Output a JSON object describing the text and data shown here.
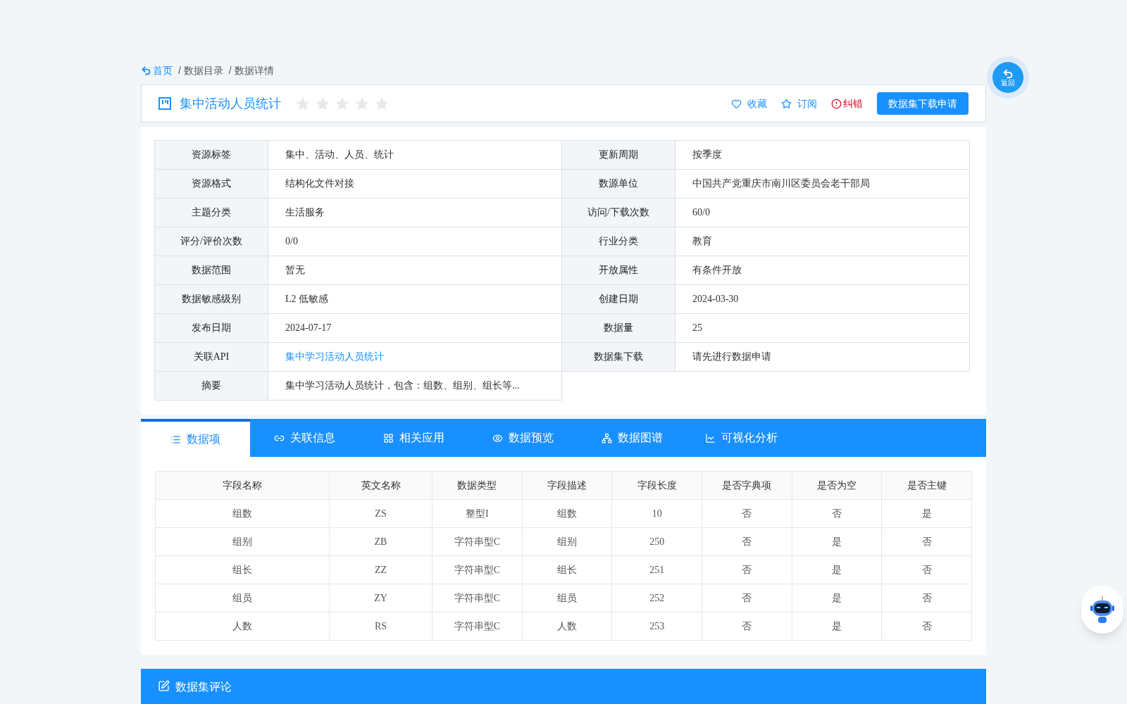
{
  "breadcrumb": [
    {
      "label": "首页",
      "kind": "home"
    },
    {
      "label": "/ 数据目录",
      "kind": "plain"
    },
    {
      "label": "/ 数据详情",
      "kind": "plain"
    }
  ],
  "header": {
    "title": "集中活动人员统计",
    "stars": 0,
    "actions": [
      {
        "label": "收藏",
        "kind": "heart"
      },
      {
        "label": "订阅",
        "kind": "star"
      },
      {
        "label": "纠错",
        "kind": "alert"
      }
    ],
    "button": "数据集下载申请"
  },
  "back_button": "返回",
  "info": [
    {
      "label": "资源标签",
      "value": "集中、活动、人员、统计",
      "kind": "text"
    },
    {
      "label": "更新周期",
      "value": "按季度",
      "kind": "text"
    },
    {
      "label": "资源格式",
      "value": "结构化文件对接",
      "kind": "text"
    },
    {
      "label": "数源单位",
      "value": "中国共产党重庆市南川区委员会老干部局",
      "kind": "text"
    },
    {
      "label": "主题分类",
      "value": "生活服务",
      "kind": "text"
    },
    {
      "label": "访问/下载次数",
      "value": "60/0",
      "kind": "text"
    },
    {
      "label": "评分/评价次数",
      "value": "0/0",
      "kind": "text"
    },
    {
      "label": "行业分类",
      "value": "教育",
      "kind": "text"
    },
    {
      "label": "数据范围",
      "value": "暂无",
      "kind": "text"
    },
    {
      "label": "开放属性",
      "value": "有条件开放",
      "kind": "text"
    },
    {
      "label": "数据敏感级别",
      "value": "L2 低敏感",
      "kind": "text"
    },
    {
      "label": "创建日期",
      "value": "2024-03-30",
      "kind": "text"
    },
    {
      "label": "发布日期",
      "value": "2024-07-17",
      "kind": "text"
    },
    {
      "label": "数据量",
      "value": "25",
      "kind": "text"
    },
    {
      "label": "关联API",
      "value": "集中学习活动人员统计",
      "kind": "link"
    },
    {
      "label": "数据集下载",
      "value": "请先进行数据申请",
      "kind": "text"
    },
    {
      "label": "摘要",
      "value": "集中学习活动人员统计，包含：组数、组别、组长等...",
      "kind": "text"
    }
  ],
  "tabs": [
    {
      "label": "数据项",
      "kind": "list",
      "selected": true
    },
    {
      "label": "关联信息",
      "kind": "link",
      "selected": false
    },
    {
      "label": "相关应用",
      "kind": "grid",
      "selected": false
    },
    {
      "label": "数据预览",
      "kind": "eye",
      "selected": false
    },
    {
      "label": "数据图谱",
      "kind": "graph",
      "selected": false
    },
    {
      "label": "可视化分析",
      "kind": "chart",
      "selected": false
    }
  ],
  "fields": {
    "columns": [
      "字段名称",
      "英文名称",
      "数据类型",
      "字段描述",
      "字段长度",
      "是否字典项",
      "是否为空",
      "是否主键"
    ],
    "rows": [
      [
        "组数",
        "ZS",
        "整型I",
        "组数",
        "10",
        "否",
        "否",
        "是"
      ],
      [
        "组别",
        "ZB",
        "字符串型C",
        "组别",
        "250",
        "否",
        "是",
        "否"
      ],
      [
        "组长",
        "ZZ",
        "字符串型C",
        "组长",
        "251",
        "否",
        "是",
        "否"
      ],
      [
        "组员",
        "ZY",
        "字符串型C",
        "组员",
        "252",
        "否",
        "是",
        "否"
      ],
      [
        "人数",
        "RS",
        "字符串型C",
        "人数",
        "253",
        "否",
        "是",
        "否"
      ]
    ]
  },
  "comments": {
    "title": "数据集评论"
  }
}
